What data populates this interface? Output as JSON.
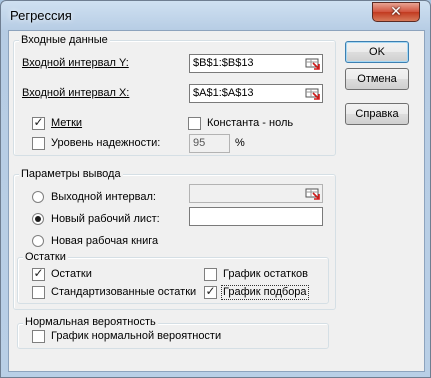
{
  "window": {
    "title": "Регрессия",
    "close_glyph": "✕"
  },
  "input_group": {
    "title": "Входные данные",
    "y_label": "Входной интервал Y:",
    "y_value": "$B$1:$B$13",
    "x_label": "Входной интервал X:",
    "x_value": "$A$1:$A$13",
    "labels_checkbox": {
      "label": "Метки",
      "checked": true
    },
    "constant_zero_checkbox": {
      "label": "Константа - ноль",
      "checked": false
    },
    "confidence_checkbox": {
      "label": "Уровень надежности:",
      "checked": false
    },
    "confidence_value": "95",
    "confidence_unit": "%"
  },
  "output_group": {
    "title": "Параметры вывода",
    "output_range": {
      "label": "Выходной интервал:",
      "selected": false,
      "value": ""
    },
    "new_sheet": {
      "label": "Новый рабочий лист:",
      "selected": true,
      "value": ""
    },
    "new_workbook": {
      "label": "Новая рабочая книга",
      "selected": false
    }
  },
  "residuals_group": {
    "title": "Остатки",
    "residuals": {
      "label": "Остатки",
      "checked": true
    },
    "standardized_residuals": {
      "label": "Стандартизованные остатки",
      "checked": false
    },
    "residual_plots": {
      "label": "График остатков",
      "checked": false
    },
    "line_fit_plots": {
      "label": "График подбора",
      "checked": true
    }
  },
  "normal_group": {
    "title": "Нормальная вероятность",
    "normal_plot": {
      "label": "График нормальной вероятности",
      "checked": false
    }
  },
  "buttons": {
    "ok": "OK",
    "cancel": "Отмена",
    "help": "Справка"
  },
  "icons": {
    "check": "✓",
    "range_picker": "range-picker-icon"
  },
  "colors": {
    "title_bar": "#b6cce4",
    "dialog_bg": "#f0f0f0",
    "close_button": "#c23a20"
  }
}
